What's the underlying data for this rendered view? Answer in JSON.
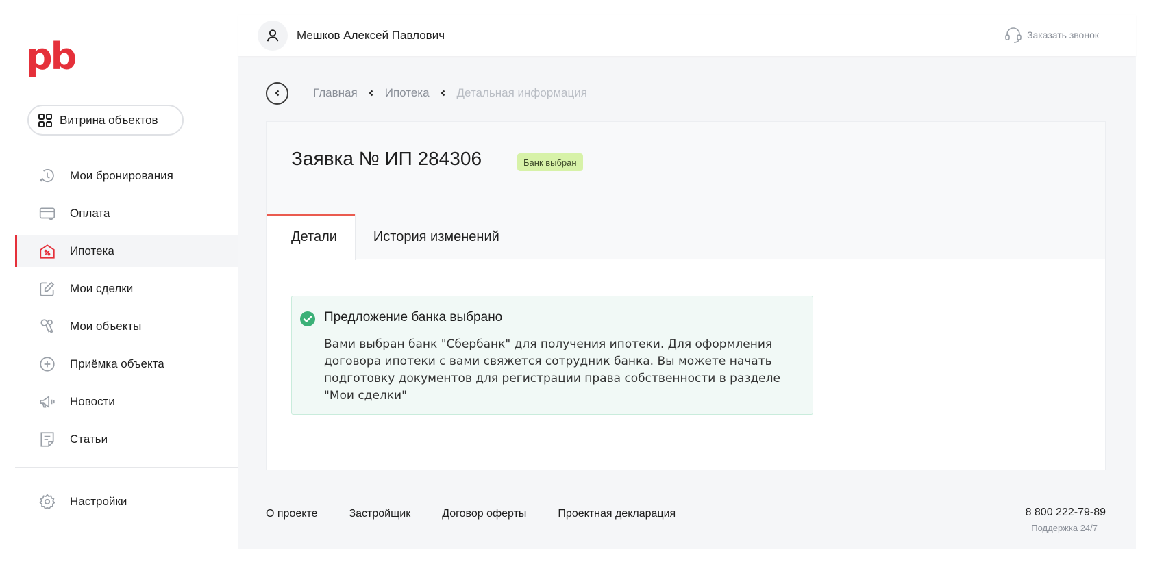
{
  "brand": {
    "logo_text": "pb",
    "accent_color": "#e5303a"
  },
  "sidebar": {
    "showcase_button": {
      "label": "Витрина объектов",
      "icon": "grid-icon"
    },
    "items": [
      {
        "label": "Мои бронирования",
        "icon": "history-icon",
        "active": false
      },
      {
        "label": "Оплата",
        "icon": "credit-card-icon",
        "active": false
      },
      {
        "label": "Ипотека",
        "icon": "house-percent-icon",
        "active": true
      },
      {
        "label": "Мои сделки",
        "icon": "edit-icon",
        "active": false
      },
      {
        "label": "Мои объекты",
        "icon": "keys-icon",
        "active": false
      },
      {
        "label": "Приёмка объекта",
        "icon": "plus-circle-icon",
        "active": false
      },
      {
        "label": "Новости",
        "icon": "megaphone-icon",
        "active": false
      },
      {
        "label": "Статьи",
        "icon": "article-icon",
        "active": false
      }
    ],
    "settings": {
      "label": "Настройки",
      "icon": "gear-icon"
    }
  },
  "header": {
    "user_name": "Мешков Алексей Павлович",
    "callback_label": "Заказать звонок"
  },
  "breadcrumb": {
    "items": [
      {
        "label": "Главная"
      },
      {
        "label": "Ипотека"
      },
      {
        "label": "Детальная информация"
      }
    ]
  },
  "application": {
    "title": "Заявка № ИП 284306",
    "status_badge": "Банк выбран",
    "status_color": "#d7f2a8",
    "tabs": [
      {
        "label": "Детали",
        "active": true
      },
      {
        "label": "История изменений",
        "active": false
      }
    ],
    "notice": {
      "title": "Предложение банка выбрано",
      "text": "Вами выбран банк \"Сбербанк\" для получения ипотеки. Для оформления договора ипотеки с вами свяжется сотрудник банка. Вы можете начать подготовку документов для регистрации права собственности в разделе \"Мои сделки\"",
      "icon": "check-circle-icon",
      "color": "#3bb077"
    }
  },
  "footer": {
    "links": [
      {
        "label": "О проекте"
      },
      {
        "label": "Застройщик"
      },
      {
        "label": "Договор оферты"
      },
      {
        "label": "Проектная декларация"
      }
    ],
    "phone": "8 800 222-79-89",
    "support": "Поддержка 24/7"
  }
}
